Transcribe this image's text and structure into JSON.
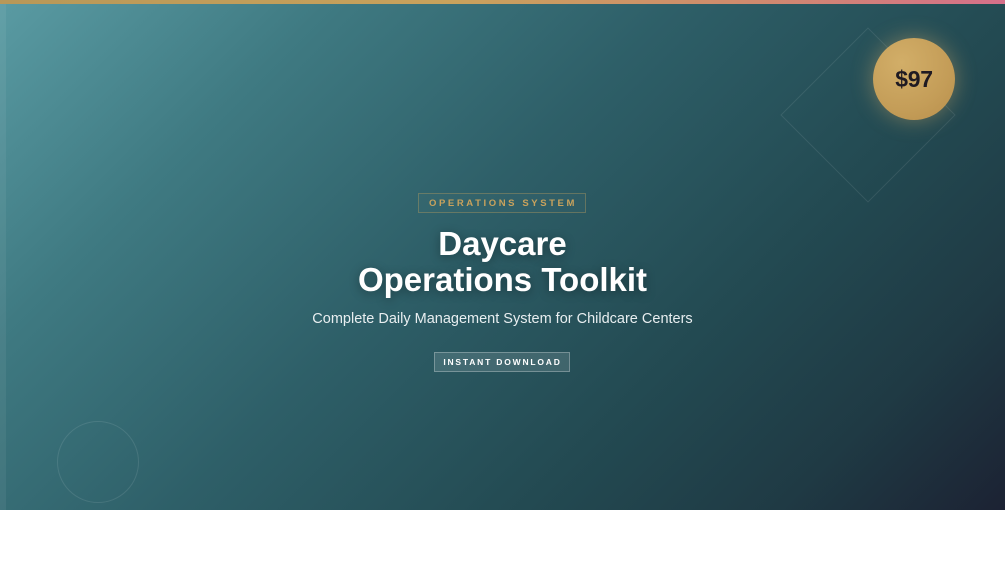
{
  "product": {
    "price": "$97",
    "category": "OPERATIONS SYSTEM",
    "title_line1": "Daycare",
    "title_line2": "Operations Toolkit",
    "subtitle": "Complete Daily Management System for Childcare Centers",
    "cta_label": "INSTANT DOWNLOAD"
  },
  "colors": {
    "accent_gold": "#c9a25c",
    "gradient_start": "#5a9ba3",
    "gradient_end": "#1c2233",
    "top_bar_end": "#d6708a"
  }
}
